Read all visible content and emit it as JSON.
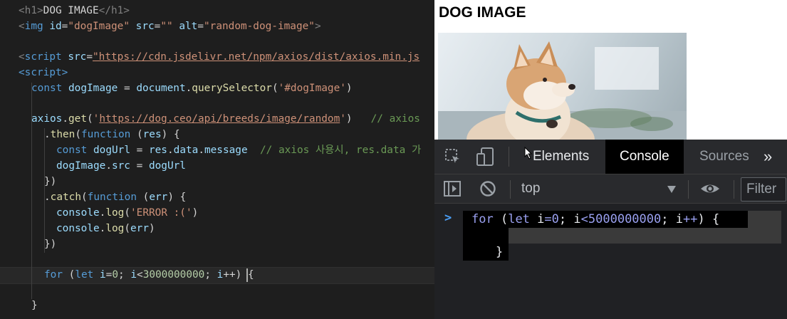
{
  "editor": {
    "lines": {
      "l1": {
        "tag_open": "<h1>",
        "text": "DOG IMAGE",
        "tag_close": "</h1>"
      },
      "l2": {
        "lt": "<",
        "tag": "img",
        "a1": "id",
        "v1": "\"dogImage\"",
        "a2": "src",
        "v2": "\"\"",
        "a3": "alt",
        "v3": "\"random-dog-image\"",
        "gt": ">"
      },
      "l4": {
        "lt": "<",
        "tag": "script",
        "a1": "src",
        "eq": "=",
        "v1": "\"https://cdn.jsdelivr.net/npm/axios/dist/axios.min.js"
      },
      "l5": {
        "tag": "<script>"
      },
      "l6": {
        "kw": "const",
        "var": "dogImage",
        "eq": " = ",
        "obj": "document",
        "dot": ".",
        "fn": "querySelector",
        "open": "(",
        "str": "'#dogImage'",
        "close": ")"
      },
      "l8": {
        "obj": "axios",
        "dot": ".",
        "fn": "get",
        "open": "(",
        "q1": "'",
        "url": "https://dog.ceo/api/breeds/image/random",
        "q2": "'",
        "close": ")",
        "comment": "// axios"
      },
      "l9": {
        "dot": ".",
        "fn": "then",
        "open": "(",
        "kw": "function",
        "sp": " (",
        "param": "res",
        "close": ") {"
      },
      "l10": {
        "kw": "const",
        "var": "dogUrl",
        "eq": " = ",
        "obj": "res",
        "d1": ".",
        "p1": "data",
        "d2": ".",
        "p2": "message",
        "comment": "// axios 사용시, res.data 가"
      },
      "l11": {
        "obj": "dogImage",
        "dot": ".",
        "prop": "src",
        "eq": " = ",
        "val": "dogUrl"
      },
      "l12": {
        "text": "})"
      },
      "l13": {
        "dot": ".",
        "fn": "catch",
        "open": "(",
        "kw": "function",
        "sp": " (",
        "param": "err",
        "close": ") {"
      },
      "l14": {
        "obj": "console",
        "dot": ".",
        "fn": "log",
        "open": "(",
        "str": "'ERROR :('",
        "close": ")"
      },
      "l15": {
        "obj": "console",
        "dot": ".",
        "fn": "log",
        "open": "(",
        "param": "err",
        "close": ")"
      },
      "l16": {
        "text": "})"
      },
      "l18": {
        "kw": "for",
        "p1": " (",
        "let": "let",
        "i1": "i",
        "eq": "=",
        "n0": "0",
        "semi1": "; ",
        "i2": "i",
        "lt": "<",
        "n1": "3000000000",
        "semi2": "; ",
        "i3": "i",
        "inc": "++",
        "close": ") {"
      },
      "l20": {
        "text": "}"
      }
    }
  },
  "browser": {
    "heading": "DOG IMAGE",
    "image_alt": "random-dog-image"
  },
  "devtools": {
    "tabs": {
      "elements": "Elements",
      "console": "Console",
      "sources": "Sources",
      "more": "»"
    },
    "toolbar": {
      "context": "top",
      "filter_placeholder": "Filter"
    },
    "console": {
      "prompt": ">",
      "cmd": {
        "kw1": "for",
        "p1": " (",
        "kw2": "let",
        "i1": " i",
        "eq": "=",
        "n0": "0",
        "semi1": "; ",
        "i2": "i",
        "lt": "<",
        "n1": "5000000000",
        "semi2": "; ",
        "i3": "i",
        "inc": "++",
        "close": ") {"
      },
      "closing_brace": "}"
    }
  },
  "colors": {
    "editor_bg": "#1e1e1e",
    "keyword": "#569cd6",
    "string": "#ce9178",
    "function": "#dcdcaa",
    "variable": "#9cdcfe",
    "comment": "#6a9955",
    "number": "#b5cea8",
    "devtools_bg": "#202124",
    "console_active_tab": "#000000"
  },
  "icons": [
    "inspect-element-icon",
    "device-toolbar-icon",
    "sidebar-toggle-icon",
    "clear-console-icon",
    "chevron-down-icon",
    "eye-icon",
    "console-prompt-icon",
    "mouse-cursor-icon"
  ]
}
